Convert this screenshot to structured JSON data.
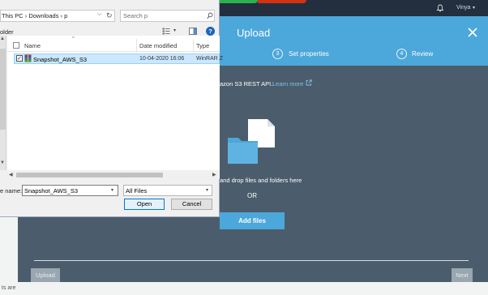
{
  "aws": {
    "user_name": "Vinya",
    "user_caret": "▾",
    "bottom_text": "ts are"
  },
  "upload_modal": {
    "title": "Upload",
    "steps": [
      {
        "number": "3",
        "label": "Set properties"
      },
      {
        "number": "4",
        "label": "Review"
      }
    ],
    "api_text": "azon S3 REST API.",
    "learn_more_label": "Learn more",
    "drag_text": "and drop files and folders here",
    "or_text": "OR",
    "add_files_label": "Add files",
    "upload_button": "Upload",
    "next_button": "Next",
    "accent_color": "#4ca7da",
    "body_color": "#4b5d6c"
  },
  "file_dialog": {
    "breadcrumb": "This PC  ›  Downloads  ›  p",
    "dropdown_glyph": "⌵",
    "refresh_glyph": "↻",
    "search_placeholder": "Search p",
    "folder_label": "older",
    "view_caret": "▾",
    "help_label": "?",
    "sort_caret": "^",
    "columns": [
      "Name",
      "Date modified",
      "Type"
    ],
    "files": [
      {
        "name": "Snapshot_AWS_S3",
        "date_modified": "10-04-2020 16:06",
        "type": "WinRAR Z",
        "checked": "✓"
      }
    ],
    "scroll_up": "▲",
    "scroll_down": "▼",
    "scroll_left": "◀",
    "scroll_right": "▶",
    "file_name_label": "e name:",
    "file_name_value": "Snapshot_AWS_S3",
    "file_name_caret": "▾",
    "filter_value": "All Files",
    "filter_caret": "▾",
    "open_label": "Open",
    "cancel_label": "Cancel"
  }
}
